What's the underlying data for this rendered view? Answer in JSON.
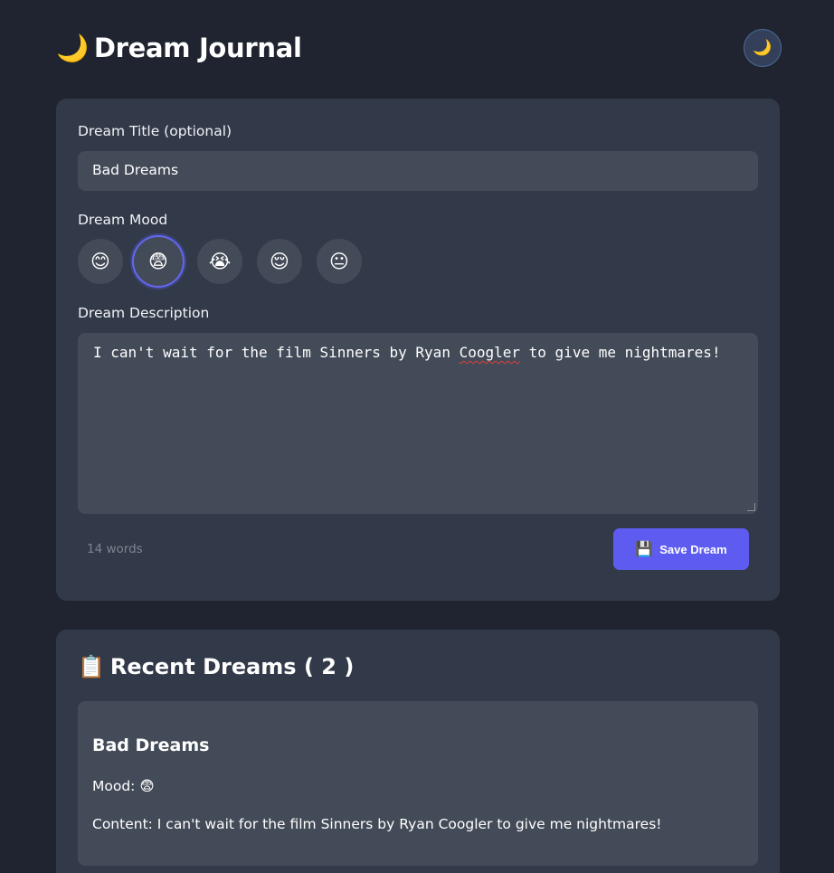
{
  "app": {
    "title": "Dream Journal",
    "title_icon": "🌙",
    "theme_toggle_icon": "🌙"
  },
  "form": {
    "title_label": "Dream Title (optional)",
    "title_value": "Bad Dreams",
    "mood_label": "Dream Mood",
    "moods": [
      {
        "emoji": "😊",
        "selected": false
      },
      {
        "emoji": "😨",
        "selected": true
      },
      {
        "emoji": "😭",
        "selected": false
      },
      {
        "emoji": "😌",
        "selected": false
      },
      {
        "emoji": "😐",
        "selected": false
      }
    ],
    "description_label": "Dream Description",
    "description_before": "I can't wait for the film Sinners by Ryan ",
    "description_misspelled": "Coogler",
    "description_after": " to give me nightmares!",
    "word_count": "14 words",
    "save_icon": "💾",
    "save_label": "Save Dream"
  },
  "recent": {
    "icon": "📋",
    "heading": "Recent Dreams ( 2 )",
    "items": [
      {
        "title": "Bad Dreams",
        "mood": "Mood: 😨",
        "content": "Content: I can't wait for the film Sinners by Ryan Coogler to give me nightmares!"
      }
    ]
  },
  "colors": {
    "background": "#1f2430",
    "card": "#323a49",
    "input": "#434b58",
    "accent": "#5e5cf0"
  }
}
